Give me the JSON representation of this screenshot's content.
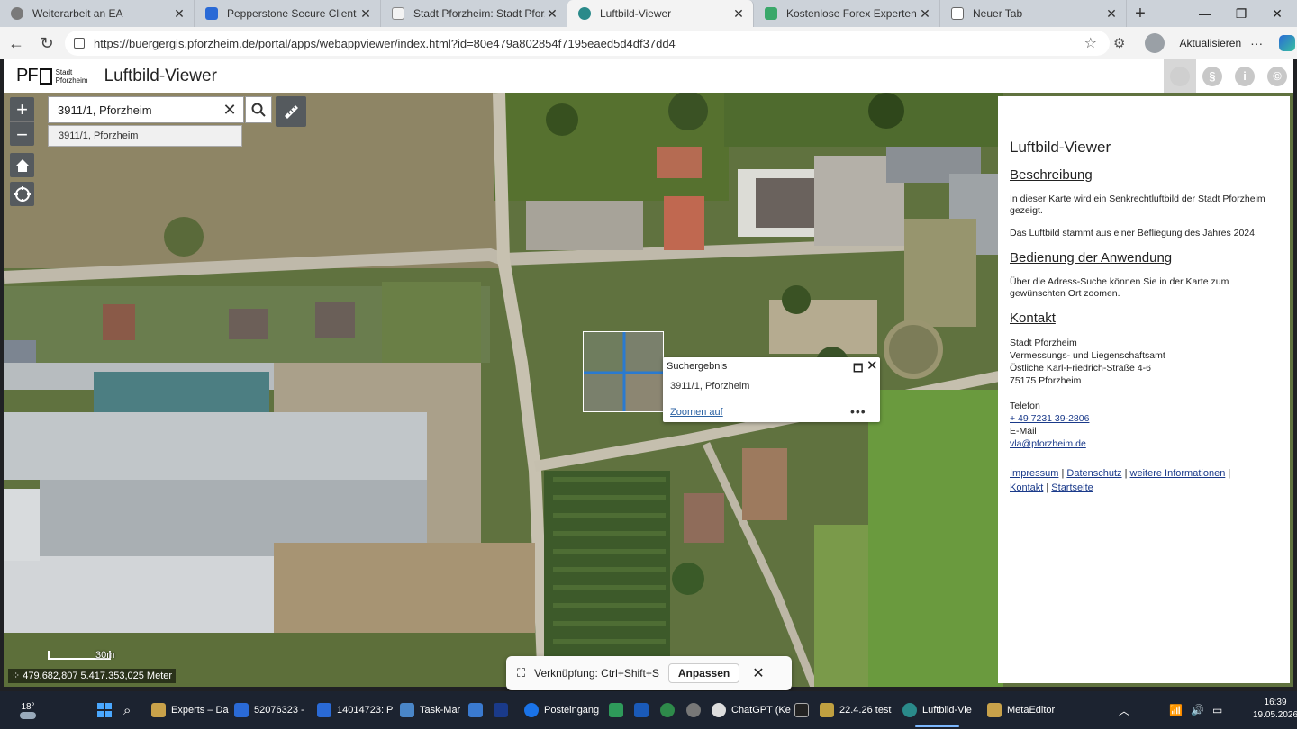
{
  "browser": {
    "tabs": [
      {
        "title": "Weiterarbeit an EA",
        "color": "#7a7a7a"
      },
      {
        "title": "Pepperstone Secure Client",
        "color": "#2a6ad6"
      },
      {
        "title": "Stadt Pforzheim: Stadt Pforzheim",
        "color": "#888888"
      },
      {
        "title": "Luftbild-Viewer",
        "color": "#2a8a8a",
        "active": true
      },
      {
        "title": "Kostenlose Forex Experten für den",
        "color": "#3aa86a"
      },
      {
        "title": "Neuer Tab",
        "color": "#666666"
      }
    ],
    "url": "https://buergergis.pforzheim.de/portal/apps/webappviewer/index.html?id=80e479a802854f7195eaed5d4df37dd4",
    "update_label": "Aktualisieren"
  },
  "app": {
    "logo_text": "PF",
    "logo_sub_1": "Stadt",
    "logo_sub_2": "Pforzheim",
    "title": "Luftbild-Viewer"
  },
  "map": {
    "search_value": "3911/1, Pforzheim",
    "suggestion": "3911/1, Pforzheim",
    "popup": {
      "title": "Suchergebnis",
      "content": "3911/1, Pforzheim",
      "zoom_label": "Zoomen auf",
      "more": "•••"
    },
    "scale_label": "30m",
    "coordinates": "479.682,807 5.417.353,025 Meter"
  },
  "panel": {
    "title": "Luftbild-Viewer",
    "desc_heading": "Beschreibung",
    "desc_p1": "In dieser Karte wird ein Senkrechtluftbild der Stadt Pforzheim gezeigt.",
    "desc_p2": "Das Luftbild stammt aus einer Befliegung des Jahres 2024.",
    "usage_heading": "Bedienung der Anwendung",
    "usage_p": "Über die Adress-Suche können Sie in der Karte zum gewünschten Ort zoomen.",
    "contact_heading": "Kontakt",
    "contact_lines": [
      "Stadt Pforzheim",
      "Vermessungs- und Liegenschaftsamt",
      "Östliche Karl-Friedrich-Straße 4-6",
      "75175 Pforzheim"
    ],
    "phone_label": "Telefon",
    "phone": "+ 49 7231 39-2806",
    "email_label": "E-Mail",
    "email": "vla@pforzheim.de",
    "links": [
      "Impressum",
      "Datenschutz",
      "weitere Informationen",
      "Kontakt",
      "Startseite"
    ]
  },
  "toast": {
    "text": "Verknüpfung: Ctrl+Shift+S",
    "button": "Anpassen"
  },
  "taskbar": {
    "weather": "18°",
    "items": [
      {
        "label": "Experts – Da",
        "color": "#c9a24a"
      },
      {
        "label": "52076323 -",
        "color": "#2a6ad6"
      },
      {
        "label": "14014723: P",
        "color": "#2a6ad6"
      },
      {
        "label": "Task-Mar",
        "color": "#4a86c8"
      },
      {
        "label": "Posteingang",
        "color": "#1a73e8"
      },
      {
        "label": "ChatGPT (Ke",
        "color": "#dddddd"
      },
      {
        "label": "22.4.26 test",
        "color": "#c0a040"
      },
      {
        "label": "Luftbild-Vie",
        "color": "#2a8a8a"
      },
      {
        "label": "MetaEditor",
        "color": "#c9a24a"
      }
    ],
    "time": "16:39",
    "date": "19.05.2026"
  }
}
